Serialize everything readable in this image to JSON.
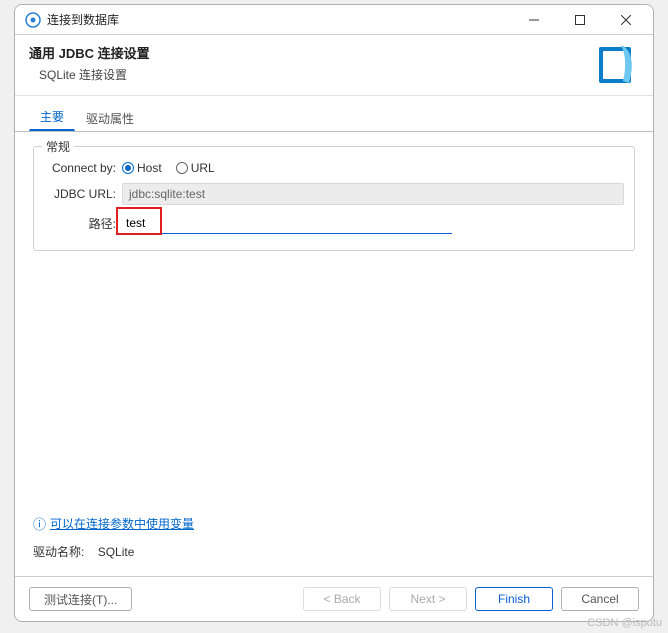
{
  "window": {
    "title": "连接到数据库"
  },
  "header": {
    "title": "通用 JDBC 连接设置",
    "subtitle": "SQLite 连接设置"
  },
  "tabs": {
    "main": "主要",
    "driver_props": "驱动属性"
  },
  "form": {
    "group_label": "常规",
    "connect_by_label": "Connect by:",
    "connect_by_host": "Host",
    "connect_by_url": "URL",
    "jdbc_url_label": "JDBC URL:",
    "jdbc_url_value": "jdbc:sqlite:test",
    "path_label": "路径:",
    "path_value": "test"
  },
  "link": {
    "text": "可以在连接参数中使用变量"
  },
  "driver": {
    "label": "驱动名称:",
    "value": "SQLite"
  },
  "buttons": {
    "test": "测试连接(T)...",
    "back": "< Back",
    "next": "Next >",
    "finish": "Finish",
    "cancel": "Cancel"
  },
  "watermark": "CSDN @ispotu"
}
